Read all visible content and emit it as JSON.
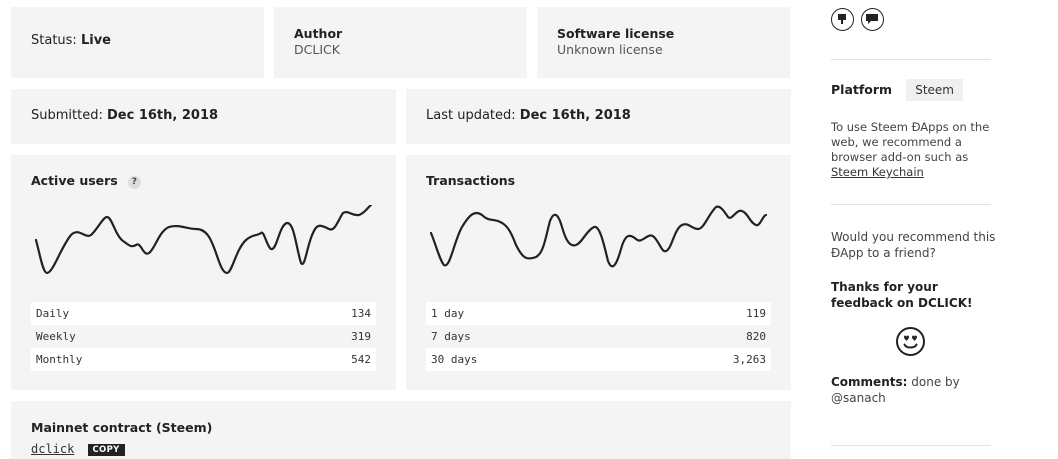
{
  "status": {
    "label": "Status:",
    "value": "Live"
  },
  "author": {
    "title": "Author",
    "value": "DCLICK"
  },
  "license": {
    "title": "Software license",
    "value": "Unknown license"
  },
  "submitted": {
    "label": "Submitted:",
    "value": "Dec 16th, 2018"
  },
  "updated": {
    "label": "Last updated:",
    "value": "Dec 16th, 2018"
  },
  "active_users": {
    "title": "Active users",
    "help": "?",
    "rows": [
      {
        "label": "Daily",
        "value": "134"
      },
      {
        "label": "Weekly",
        "value": "319"
      },
      {
        "label": "Monthly",
        "value": "542"
      }
    ]
  },
  "transactions": {
    "title": "Transactions",
    "rows": [
      {
        "label": "1 day",
        "value": "119"
      },
      {
        "label": "7 days",
        "value": "820"
      },
      {
        "label": "30 days",
        "value": "3,263"
      }
    ]
  },
  "contract": {
    "title": "Mainnet contract (Steem)",
    "account": "dclick",
    "copy_label": "COPY"
  },
  "sidebar": {
    "icons": [
      "github-icon",
      "chat-icon"
    ],
    "platform_label": "Platform",
    "platform_value": "Steem",
    "platform_note": "To use Steem ĐApps on the web, we recommend a browser add-on such as",
    "keychain_link": "Steem Keychain",
    "recommend_question": "Would you recommend this ĐApp to a friend?",
    "feedback_thanks": "Thanks for your feedback on DCLICK!",
    "feedback_icon": "smiley-heart-eyes-icon",
    "comments_label": "Comments:",
    "comments_value": "done by @sanach"
  },
  "colors": {
    "card_bg": "#f4f4f4",
    "line": "#222222",
    "alt_row": "#ffffff"
  }
}
